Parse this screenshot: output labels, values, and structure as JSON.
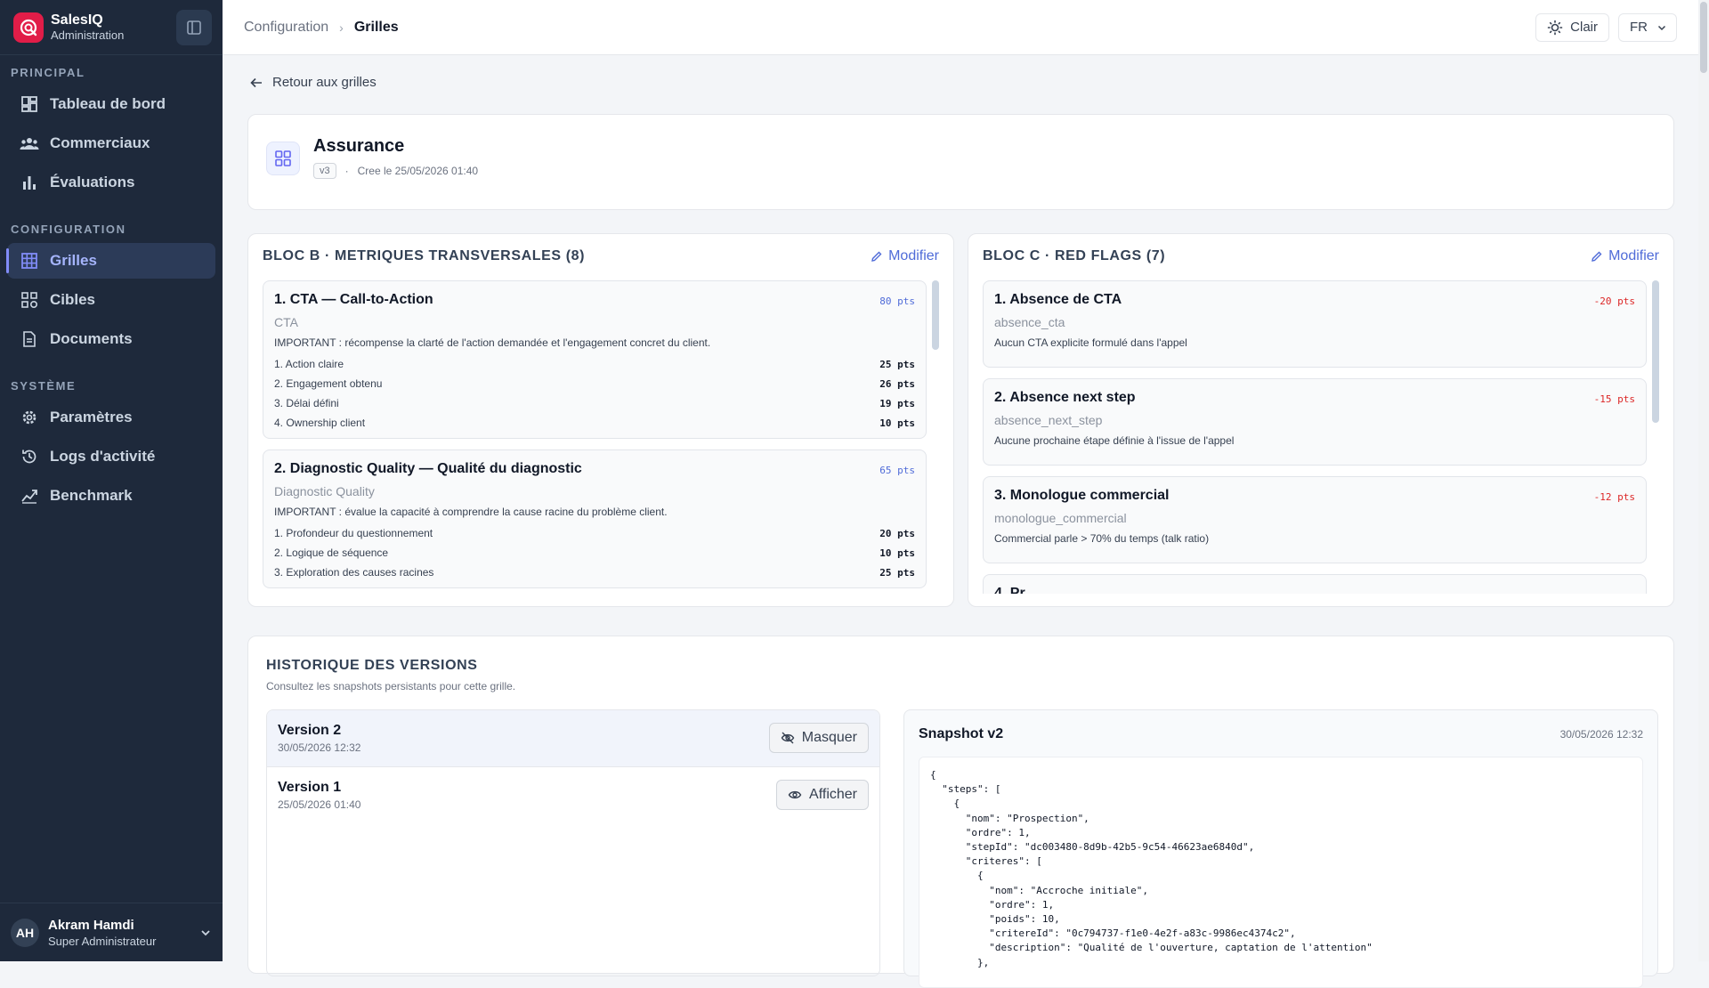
{
  "brand": {
    "name": "SalesIQ",
    "subtitle": "Administration"
  },
  "sidebar": {
    "sections": [
      {
        "label": "PRINCIPAL",
        "items": [
          {
            "label": "Tableau de bord",
            "icon": "dashboard-icon"
          },
          {
            "label": "Commerciaux",
            "icon": "users-icon"
          },
          {
            "label": "Évaluations",
            "icon": "bar-chart-icon"
          }
        ]
      },
      {
        "label": "CONFIGURATION",
        "items": [
          {
            "label": "Grilles",
            "icon": "grid-icon",
            "active": true
          },
          {
            "label": "Cibles",
            "icon": "targets-icon"
          },
          {
            "label": "Documents",
            "icon": "document-icon"
          }
        ]
      },
      {
        "label": "SYSTÈME",
        "items": [
          {
            "label": "Paramètres",
            "icon": "gear-icon"
          },
          {
            "label": "Logs d'activité",
            "icon": "history-icon"
          },
          {
            "label": "Benchmark",
            "icon": "trend-icon"
          }
        ]
      }
    ]
  },
  "user": {
    "initials": "AH",
    "name": "Akram Hamdi",
    "role": "Super Administrateur"
  },
  "topbar": {
    "breadcrumb": [
      "Configuration",
      "Grilles"
    ],
    "theme_label": "Clair",
    "lang_label": "FR"
  },
  "back_label": "Retour aux grilles",
  "grid": {
    "title": "Assurance",
    "version": "v3",
    "dot": "·",
    "created": "Cree le 25/05/2026 01:40"
  },
  "bloc_b": {
    "title": "BLOC B · METRIQUES TRANSVERSALES (8)",
    "edit_label": "Modifier",
    "metrics": [
      {
        "title": "1. CTA — Call-to-Action",
        "points": "80 pts",
        "code": "CTA",
        "desc": "IMPORTANT : récompense la clarté de l'action demandée et l'engagement concret du client.",
        "criteria": [
          {
            "label": "1. Action claire",
            "pts": "25 pts"
          },
          {
            "label": "2. Engagement obtenu",
            "pts": "26 pts"
          },
          {
            "label": "3. Délai défini",
            "pts": "19 pts"
          },
          {
            "label": "4. Ownership client",
            "pts": "10 pts"
          }
        ]
      },
      {
        "title": "2. Diagnostic Quality — Qualité du diagnostic",
        "points": "65 pts",
        "code": "Diagnostic Quality",
        "desc": "IMPORTANT : évalue la capacité à comprendre la cause racine du problème client.",
        "criteria": [
          {
            "label": "1. Profondeur du questionnement",
            "pts": "20 pts"
          },
          {
            "label": "2. Logique de séquence",
            "pts": "10 pts"
          },
          {
            "label": "3. Exploration des causes racines",
            "pts": "25 pts"
          }
        ]
      }
    ]
  },
  "bloc_c": {
    "title": "BLOC C · RED FLAGS (7)",
    "edit_label": "Modifier",
    "flags": [
      {
        "title": "1. Absence de CTA",
        "points": "-20 pts",
        "code": "absence_cta",
        "desc": "Aucun CTA explicite formulé dans l'appel"
      },
      {
        "title": "2. Absence next step",
        "points": "-15 pts",
        "code": "absence_next_step",
        "desc": "Aucune prochaine étape définie à l'issue de l'appel"
      },
      {
        "title": "3. Monologue commercial",
        "points": "-12 pts",
        "code": "monologue_commercial",
        "desc": "Commercial parle > 70% du temps (talk ratio)"
      },
      {
        "title": "4. Pr...",
        "points": "",
        "code": "",
        "desc": ""
      }
    ]
  },
  "history": {
    "title": "HISTORIQUE DES VERSIONS",
    "subtitle": "Consultez les snapshots persistants pour cette grille.",
    "versions": [
      {
        "name": "Version 2",
        "date": "30/05/2026 12:32",
        "action": "Masquer",
        "action_icon": "eye-off-icon",
        "selected": true
      },
      {
        "name": "Version 1",
        "date": "25/05/2026 01:40",
        "action": "Afficher",
        "action_icon": "eye-icon",
        "selected": false
      }
    ],
    "snapshot": {
      "title": "Snapshot v2",
      "date": "30/05/2026 12:32",
      "code": "{\n  \"steps\": [\n    {\n      \"nom\": \"Prospection\",\n      \"ordre\": 1,\n      \"stepId\": \"dc003480-8d9b-42b5-9c54-46623ae6840d\",\n      \"criteres\": [\n        {\n          \"nom\": \"Accroche initiale\",\n          \"ordre\": 1,\n          \"poids\": 10,\n          \"critereId\": \"0c794737-f1e0-4e2f-a83c-9986ec4374c2\",\n          \"description\": \"Qualité de l'ouverture, captation de l'attention\"\n        },"
    }
  },
  "colors": {
    "sidebar_bg": "#1e293b",
    "accent": "#4f6bd8",
    "brand": "#e11d48",
    "danger": "#dc2626"
  }
}
